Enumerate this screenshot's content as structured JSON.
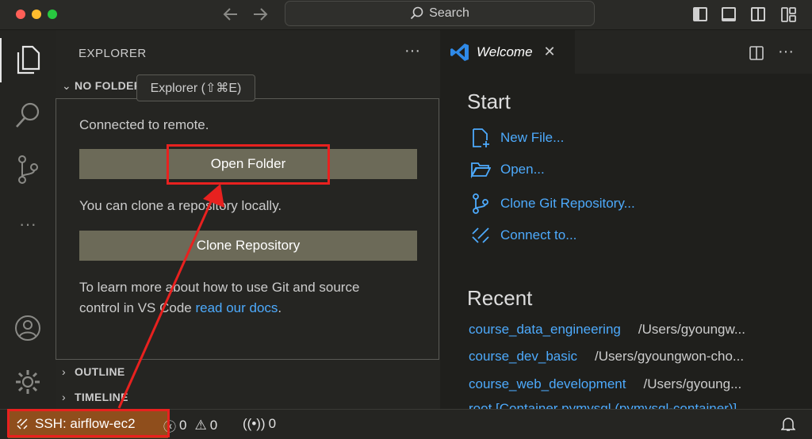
{
  "titlebar": {
    "search_label": "Search",
    "icons": [
      "arrow-left-icon",
      "arrow-right-icon",
      "search-icon",
      "toggle-sidebar-icon",
      "toggle-panel-icon",
      "toggle-secondary-sidebar-icon",
      "customize-layout-icon"
    ]
  },
  "activitybar": {
    "items": [
      "explorer-icon",
      "search-icon",
      "source-control-icon",
      "more-icon",
      "account-icon",
      "settings-gear-icon"
    ]
  },
  "sidebar": {
    "title": "EXPLORER",
    "more": "···",
    "no_folder_label": "NO FOLDER OPENED",
    "tooltip": "Explorer (⇧⌘E)",
    "connected_text": "Connected to remote.",
    "open_folder_label": "Open Folder",
    "clone_text": "You can clone a repository locally.",
    "clone_button_label": "Clone Repository",
    "learn_text_1": "To learn more about how to use Git and source",
    "learn_text_2": "control in VS Code ",
    "learn_link": "read our docs",
    "learn_text_3": ".",
    "outline_label": "OUTLINE",
    "timeline_label": "TIMELINE"
  },
  "editor": {
    "tab_title": "Welcome",
    "tab_close": "✕",
    "start_heading": "Start",
    "start_items": [
      {
        "label": "New File...",
        "icon": "new-file-icon"
      },
      {
        "label": "Open...",
        "icon": "open-folder-icon"
      },
      {
        "label": "Clone Git Repository...",
        "icon": "git-clone-icon"
      },
      {
        "label": "Connect to...",
        "icon": "remote-connect-icon"
      }
    ],
    "recent_heading": "Recent",
    "recent_items": [
      {
        "name": "course_data_engineering",
        "path": "/Users/gyoungw..."
      },
      {
        "name": "course_dev_basic",
        "path": "/Users/gyoungwon-cho..."
      },
      {
        "name": "course_web_development",
        "path": "/Users/gyoung..."
      },
      {
        "name": "root [Container pymysql (pymysql-container)]",
        "path": ""
      }
    ]
  },
  "statusbar": {
    "remote_label": "SSH: airflow-ec2",
    "errors": "0",
    "warnings": "0",
    "ports": "0"
  },
  "colors": {
    "accent_link": "#4daafc",
    "button_bg": "#6c6a58",
    "remote_bg": "#8f4e1c",
    "annotation_red": "#e8211f"
  }
}
